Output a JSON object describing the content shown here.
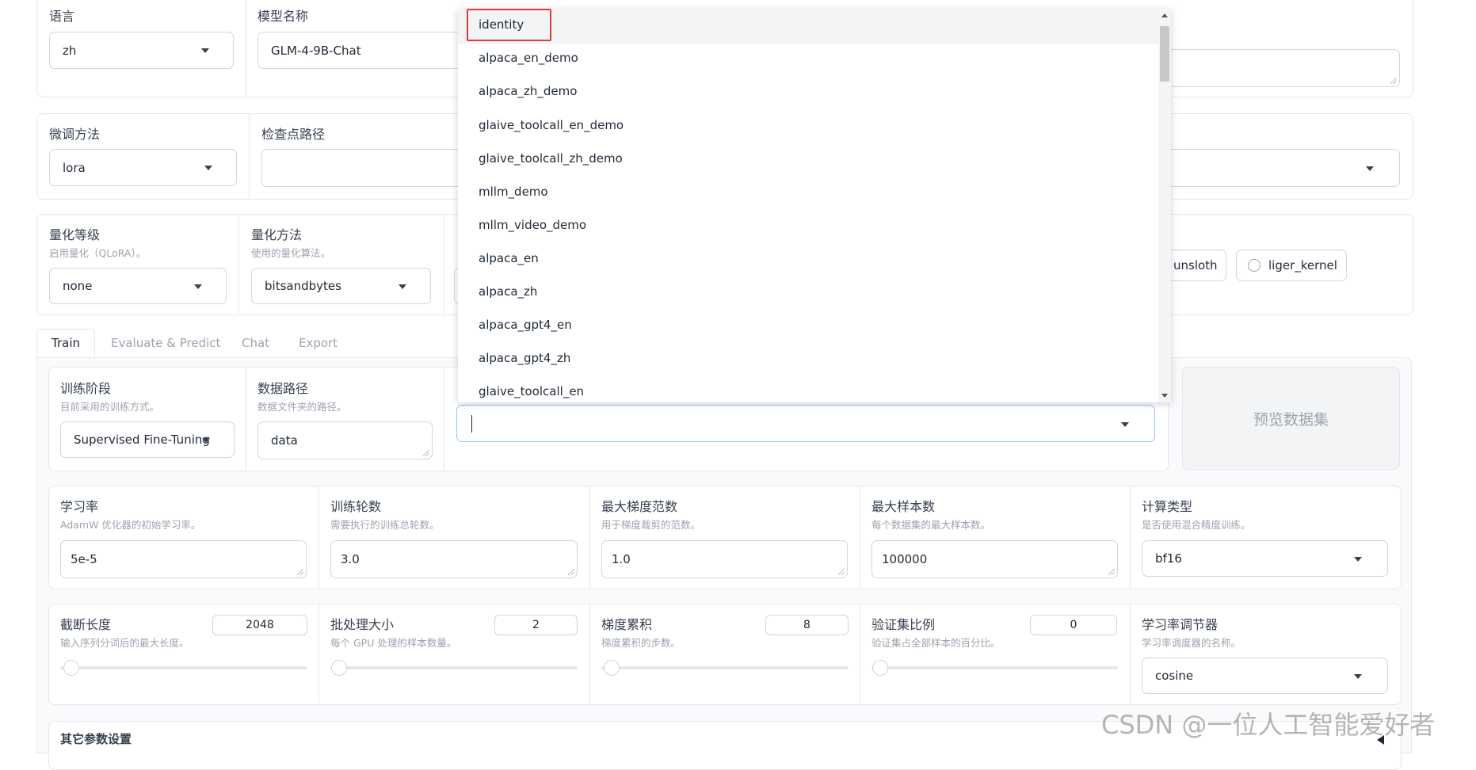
{
  "row1": {
    "lang_label": "语言",
    "lang_value": "zh",
    "model_label": "模型名称",
    "model_value": "GLM-4-9B-Chat"
  },
  "row2": {
    "method_label": "微调方法",
    "method_value": "lora",
    "ckpt_label": "检查点路径"
  },
  "row3": {
    "quant_label": "量化等级",
    "quant_desc": "启用量化（QLoRA）。",
    "quant_value": "none",
    "qmethod_label": "量化方法",
    "qmethod_desc": "使用的量化算法。",
    "qmethod_value": "bitsandbytes",
    "opt_unsloth": "unsloth",
    "opt_liger": "liger_kernel"
  },
  "tabs": [
    "Train",
    "Evaluate & Predict",
    "Chat",
    "Export"
  ],
  "train": {
    "stage_label": "训练阶段",
    "stage_desc": "目前采用的训练方式。",
    "stage_value": "Supervised Fine-Tuning",
    "datadir_label": "数据路径",
    "datadir_desc": "数据文件夹的路径。",
    "datadir_value": "data",
    "dataset_value": "",
    "preview_label": "预览数据集"
  },
  "params": [
    {
      "label": "学习率",
      "desc": "AdamW 优化器的初始学习率。",
      "value": "5e-5"
    },
    {
      "label": "训练轮数",
      "desc": "需要执行的训练总轮数。",
      "value": "3.0"
    },
    {
      "label": "最大梯度范数",
      "desc": "用于梯度裁剪的范数。",
      "value": "1.0"
    },
    {
      "label": "最大样本数",
      "desc": "每个数据集的最大样本数。",
      "value": "100000"
    },
    {
      "label": "计算类型",
      "desc": "是否使用混合精度训练。",
      "value": "bf16"
    }
  ],
  "sliders": [
    {
      "label": "截断长度",
      "desc": "输入序列分词后的最大长度。",
      "value": "2048",
      "fraction": 0.03
    },
    {
      "label": "批处理大小",
      "desc": "每个 GPU 处理的样本数量。",
      "value": "2",
      "fraction": 0.0
    },
    {
      "label": "梯度累积",
      "desc": "梯度累积的步数。",
      "value": "8",
      "fraction": 0.03
    },
    {
      "label": "验证集比例",
      "desc": "验证集占全部样本的百分比。",
      "value": "0",
      "fraction": 0.0
    }
  ],
  "scheduler": {
    "label": "学习率调节器",
    "desc": "学习率调度器的名称。",
    "value": "cosine"
  },
  "other_params_label": "其它参数设置",
  "dropdown": {
    "options": [
      "identity",
      "alpaca_en_demo",
      "alpaca_zh_demo",
      "glaive_toolcall_en_demo",
      "glaive_toolcall_zh_demo",
      "mllm_demo",
      "mllm_video_demo",
      "alpaca_en",
      "alpaca_zh",
      "alpaca_gpt4_en",
      "alpaca_gpt4_zh",
      "glaive_toolcall_en"
    ]
  },
  "watermark": "CSDN @一位人工智能爱好者",
  "colors": {
    "highlight_border": "#e53935",
    "border": "#e5e7eb",
    "focus": "#93c5fd"
  }
}
